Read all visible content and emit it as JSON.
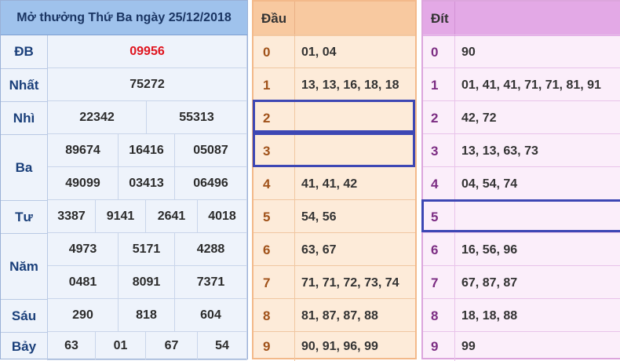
{
  "results": {
    "title": "Mở thưởng Thứ Ba ngày 25/12/2018",
    "rows": [
      {
        "label": "ĐB",
        "values": [
          "09956"
        ]
      },
      {
        "label": "Nhất",
        "values": [
          "75272"
        ]
      },
      {
        "label": "Nhì",
        "values": [
          "22342",
          "55313"
        ]
      },
      {
        "label": "Ba",
        "values": [
          "89674",
          "16416",
          "05087",
          "49099",
          "03413",
          "06496"
        ]
      },
      {
        "label": "Tư",
        "values": [
          "3387",
          "9141",
          "2641",
          "4018"
        ]
      },
      {
        "label": "Năm",
        "values": [
          "4973",
          "5171",
          "4288",
          "0481",
          "8091",
          "7371"
        ]
      },
      {
        "label": "Sáu",
        "values": [
          "290",
          "818",
          "604"
        ]
      },
      {
        "label": "Bảy",
        "values": [
          "63",
          "01",
          "67",
          "54"
        ]
      }
    ]
  },
  "dau": {
    "header": "Đầu",
    "rows": [
      {
        "num": "0",
        "values": "01, 04"
      },
      {
        "num": "1",
        "values": "13, 13, 16, 18, 18"
      },
      {
        "num": "2",
        "values": ""
      },
      {
        "num": "3",
        "values": ""
      },
      {
        "num": "4",
        "values": "41, 41, 42"
      },
      {
        "num": "5",
        "values": "54, 56"
      },
      {
        "num": "6",
        "values": "63, 67"
      },
      {
        "num": "7",
        "values": "71, 71, 72, 73, 74"
      },
      {
        "num": "8",
        "values": "81, 87, 87, 88"
      },
      {
        "num": "9",
        "values": "90, 91, 96, 99"
      }
    ]
  },
  "dit": {
    "header": "Đít",
    "rows": [
      {
        "num": "0",
        "values": "90"
      },
      {
        "num": "1",
        "values": "01, 41, 41, 71, 71, 81, 91"
      },
      {
        "num": "2",
        "values": "42, 72"
      },
      {
        "num": "3",
        "values": "13, 13, 63, 73"
      },
      {
        "num": "4",
        "values": "04, 54, 74"
      },
      {
        "num": "5",
        "values": ""
      },
      {
        "num": "6",
        "values": "16, 56, 96"
      },
      {
        "num": "7",
        "values": "67, 87, 87"
      },
      {
        "num": "8",
        "values": "18, 18, 88"
      },
      {
        "num": "9",
        "values": "99"
      }
    ]
  },
  "colors": {
    "special_prize": "#e0141e",
    "highlight_box": "#3d47b4"
  }
}
